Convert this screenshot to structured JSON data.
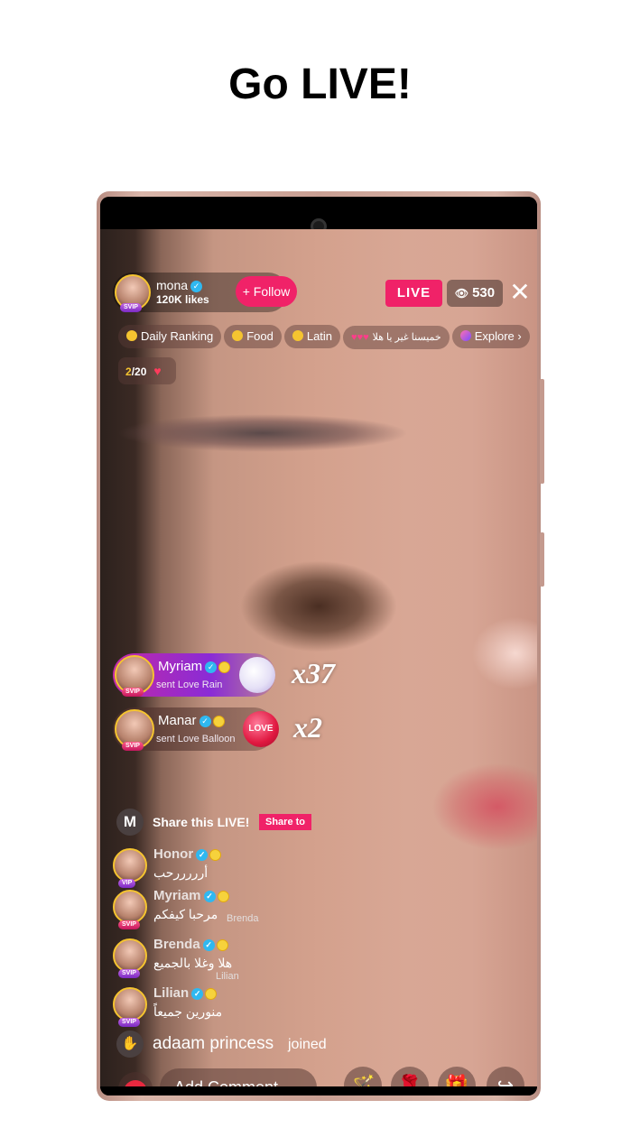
{
  "page_title": "Go LIVE!",
  "host": {
    "name": "mona",
    "likes": "120K likes",
    "vip_badge": "SVIP",
    "follow_label": "Follow",
    "follow_plus": "+"
  },
  "live_label": "LIVE",
  "viewer_count": "530",
  "close_symbol": "✕",
  "tags": [
    {
      "label": "Daily Ranking"
    },
    {
      "label": "Food"
    },
    {
      "label": "Latin"
    },
    {
      "label": "خميسنا غير يا هلا"
    },
    {
      "label": "Explore"
    }
  ],
  "ranking": {
    "current": "2",
    "total": "/20"
  },
  "gifts": [
    {
      "name": "Myriam",
      "text": "sent Love Rain",
      "multiplier": "x37",
      "badge": "SVIP"
    },
    {
      "name": "Manar",
      "text": "sent Love Balloon",
      "multiplier": "x2",
      "badge": "SVIP",
      "gift_label": "LOVE"
    }
  ],
  "share": {
    "logo": "M",
    "text": "Share this LIVE!",
    "button": "Share to"
  },
  "messages": [
    {
      "name": "Honor",
      "text": "أرررررحب",
      "badge": "VIP",
      "tag": ""
    },
    {
      "name": "Myriam",
      "text": "مرحبا كيفكم",
      "badge": "SVIP",
      "tag": "Brenda"
    },
    {
      "name": "Brenda",
      "text": "هلا وغلا بالجميع",
      "badge": "SVIP",
      "tag": "Lilian"
    },
    {
      "name": "Lilian",
      "text": "منورين جميعاً",
      "badge": "SVIP",
      "tag": ""
    }
  ],
  "joined": {
    "name": "adaam princess",
    "text": "joined"
  },
  "comment_placeholder": "Add Comment...",
  "love_label": "LOVE",
  "colors": {
    "accent": "#f02268",
    "verified": "#2fb8f0",
    "gold": "#f5c430"
  }
}
